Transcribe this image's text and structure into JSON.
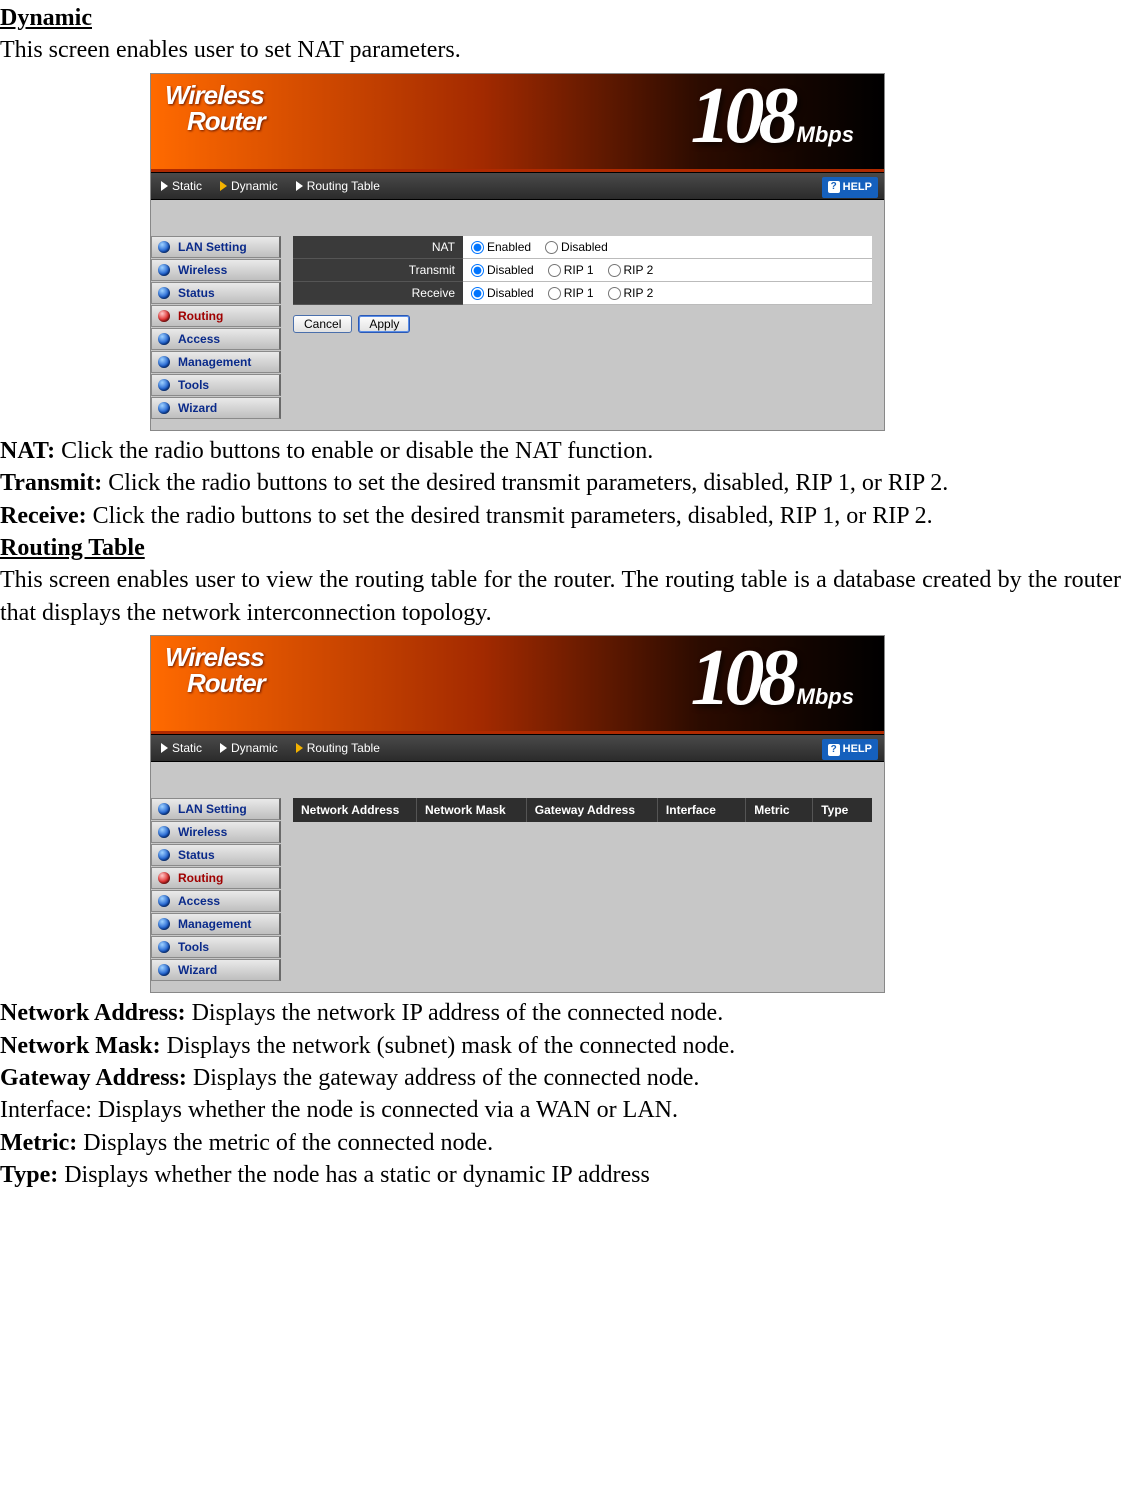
{
  "section1": {
    "heading": "Dynamic",
    "intro": "This screen enables user to set NAT parameters."
  },
  "router_banner": {
    "logo_line1": "Wireless",
    "logo_line2": "Router",
    "speed_num": "108",
    "speed_unit": "Mbps"
  },
  "topnav": {
    "tabs": [
      {
        "label": "Static"
      },
      {
        "label": "Dynamic"
      },
      {
        "label": "Routing Table"
      }
    ],
    "active_index_shot1": 1,
    "active_index_shot2": 2,
    "help_label": "HELP"
  },
  "sidebar": {
    "items": [
      {
        "label": "LAN Setting"
      },
      {
        "label": "Wireless"
      },
      {
        "label": "Status"
      },
      {
        "label": "Routing"
      },
      {
        "label": "Access"
      },
      {
        "label": "Management"
      },
      {
        "label": "Tools"
      },
      {
        "label": "Wizard"
      }
    ],
    "active_index": 3
  },
  "dynamic_form": {
    "rows": [
      {
        "label": "NAT",
        "options": [
          "Enabled",
          "Disabled"
        ],
        "selected": 0
      },
      {
        "label": "Transmit",
        "options": [
          "Disabled",
          "RIP 1",
          "RIP 2"
        ],
        "selected": 0
      },
      {
        "label": "Receive",
        "options": [
          "Disabled",
          "RIP 1",
          "RIP 2"
        ],
        "selected": 0
      }
    ],
    "cancel_label": "Cancel",
    "apply_label": "Apply"
  },
  "desc1": [
    {
      "term": "NAT:",
      "text": " Click the radio buttons to enable or disable the NAT function."
    },
    {
      "term": "Transmit:",
      "text": " Click the radio buttons to set the desired transmit parameters, disabled, RIP 1, or RIP 2."
    },
    {
      "term": "Receive:",
      "text": " Click the radio buttons to set the desired transmit parameters, disabled, RIP 1, or RIP 2."
    }
  ],
  "section2": {
    "heading": "Routing Table",
    "intro": "This screen enables user to view the routing table for the router. The routing table is a database created by the router that displays the network interconnection topology."
  },
  "routing_table": {
    "columns": [
      "Network Address",
      "Network Mask",
      "Gateway Address",
      "Interface",
      "Metric",
      "Type"
    ]
  },
  "desc2": [
    {
      "term": "Network Address:",
      "text": " Displays the network IP address of the connected node."
    },
    {
      "term": "Network Mask:",
      "text": " Displays the network (subnet) mask of the connected node."
    },
    {
      "term": "Gateway Address:",
      "text": " Displays the gateway address of the connected node."
    },
    {
      "term": "Interface:",
      "text": " Displays whether the node is connected via a WAN or LAN.",
      "plain_term": true
    },
    {
      "term": "Metric:",
      "text": " Displays the metric of the connected node."
    },
    {
      "term": "Type:",
      "text": " Displays whether the node has a static or dynamic IP address"
    }
  ]
}
